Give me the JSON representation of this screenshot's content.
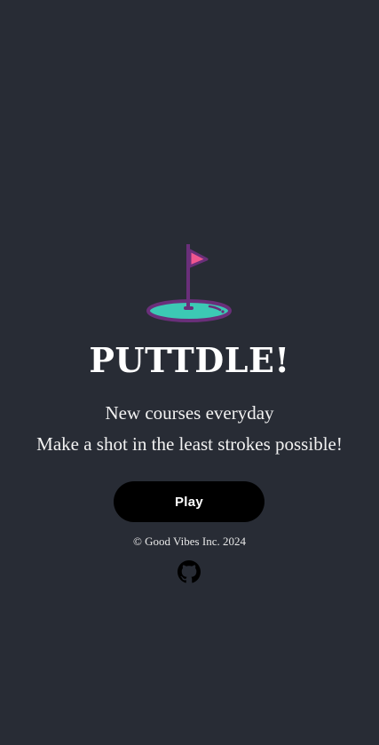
{
  "app": {
    "title": "PUTTDLE!",
    "tagline": "New courses everyday",
    "description": "Make a shot in the least strokes possible!"
  },
  "actions": {
    "play_label": "Play"
  },
  "footer": {
    "copyright": "© Good Vibes Inc. 2024",
    "github_icon": "github-icon"
  },
  "colors": {
    "background": "#282c35",
    "green": "#3cc9b4",
    "flag": "#f0568f",
    "outline": "#6a2f7a",
    "button": "#000000"
  }
}
